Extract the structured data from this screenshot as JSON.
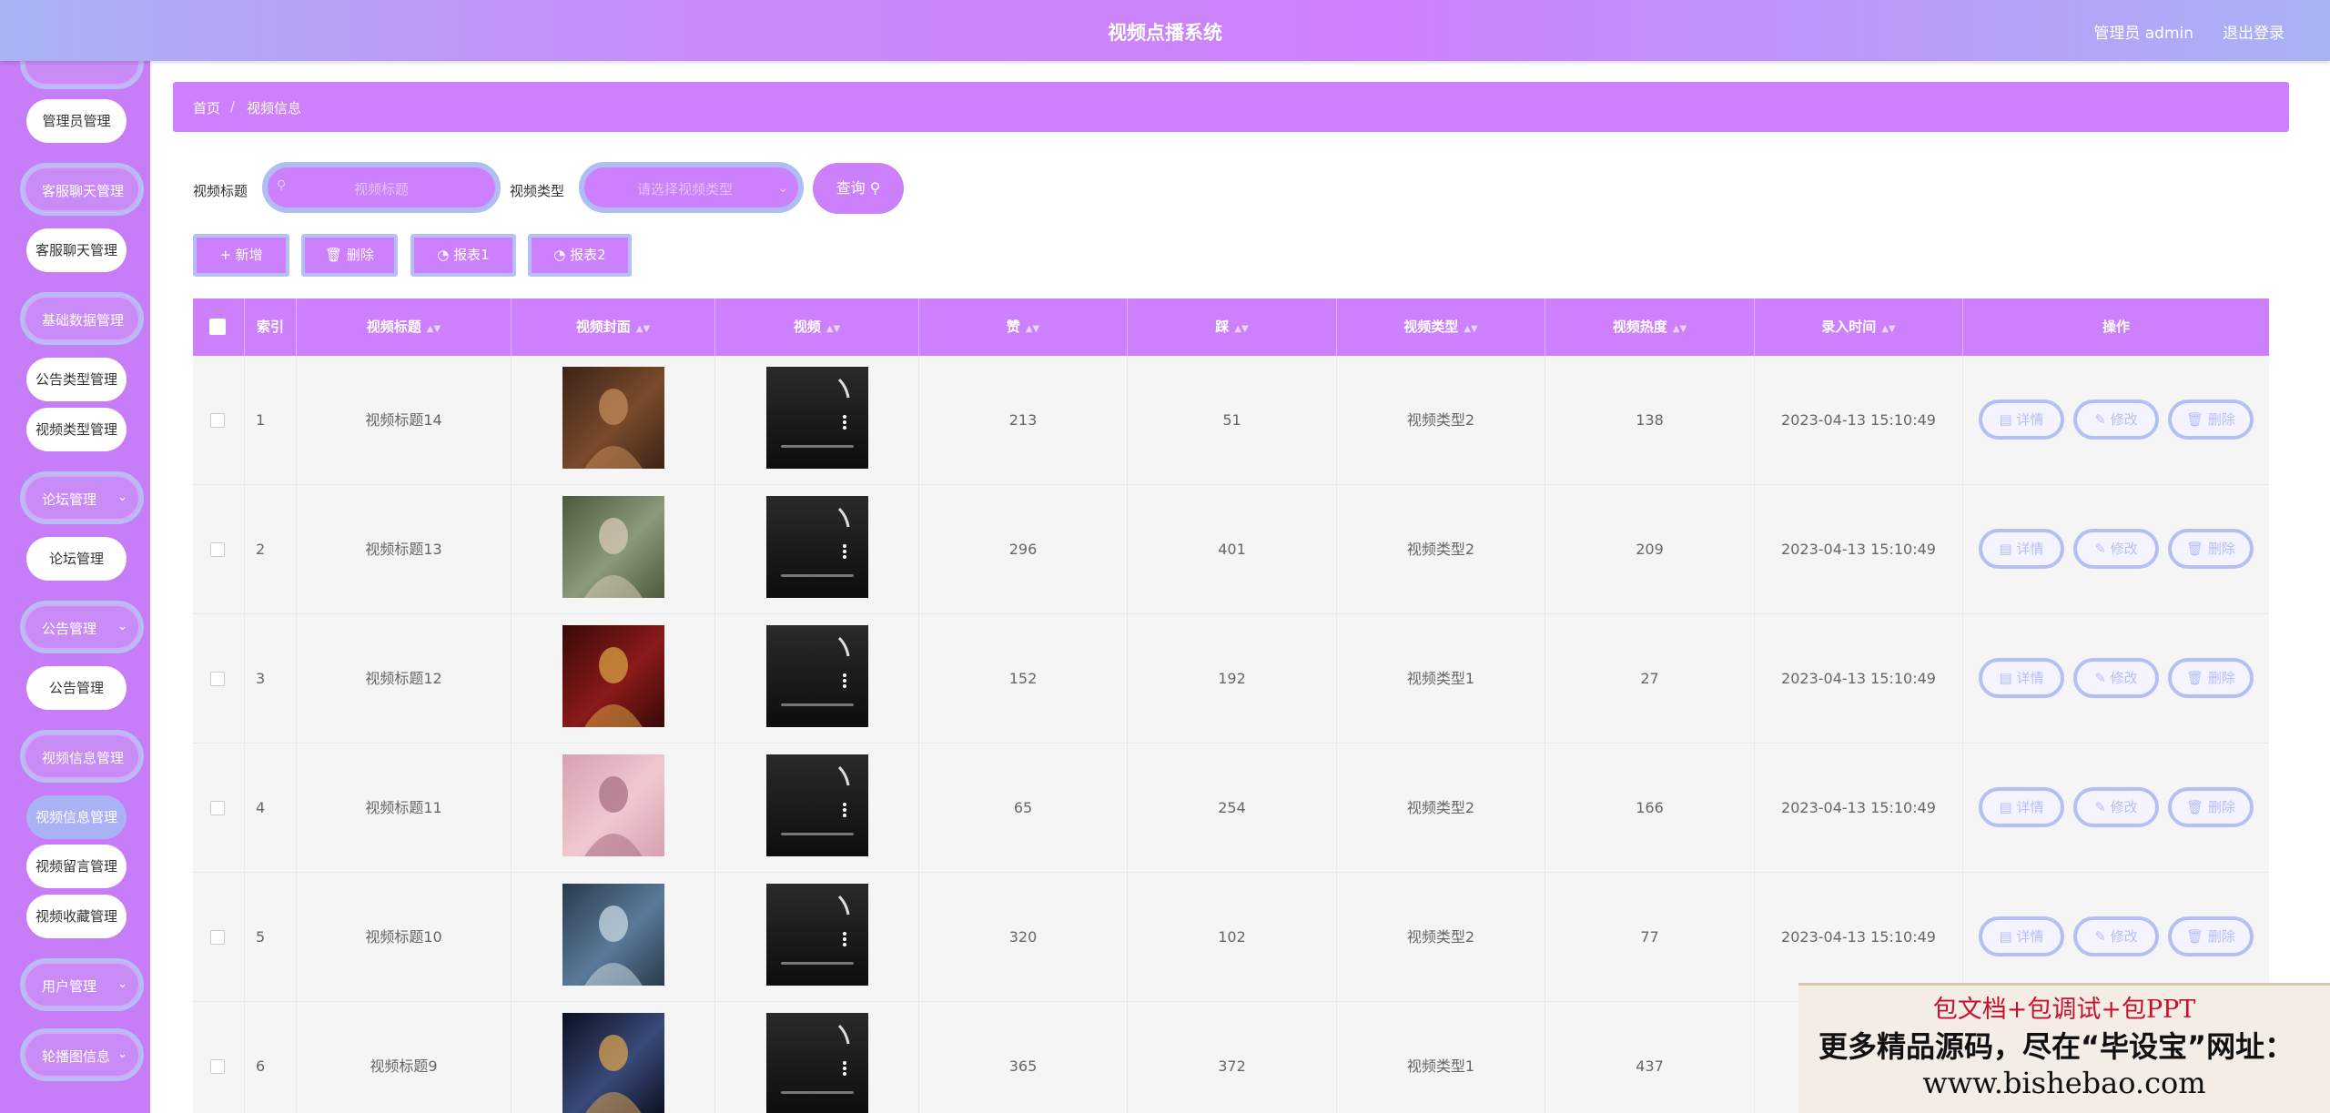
{
  "header": {
    "title": "视频点播系统",
    "admin_label": "管理员 admin",
    "logout_label": "退出登录"
  },
  "sidebar": {
    "groups": [
      {
        "label": "客服聊天管理"
      },
      {
        "label": "基础数据管理"
      },
      {
        "label": "论坛管理"
      },
      {
        "label": "公告管理"
      },
      {
        "label": "视频信息管理"
      },
      {
        "label": "用户管理"
      },
      {
        "label": "轮播图信息"
      }
    ],
    "items": [
      {
        "label": "管理员管理"
      },
      {
        "label": "客服聊天管理"
      },
      {
        "label": "公告类型管理"
      },
      {
        "label": "视频类型管理"
      },
      {
        "label": "论坛管理"
      },
      {
        "label": "公告管理"
      },
      {
        "label": "视频信息管理"
      },
      {
        "label": "视频留言管理"
      },
      {
        "label": "视频收藏管理"
      }
    ]
  },
  "breadcrumb": {
    "home": "首页",
    "sep": "/",
    "current": "视频信息"
  },
  "search": {
    "title_label": "视频标题",
    "title_placeholder": "视频标题",
    "type_label": "视频类型",
    "type_placeholder": "请选择视频类型",
    "query_label": "查询"
  },
  "actions": {
    "add": "新增",
    "delete": "删除",
    "report1": "报表1",
    "report2": "报表2"
  },
  "table": {
    "headers": [
      "索引",
      "视频标题",
      "视频封面",
      "视频",
      "赞",
      "踩",
      "视频类型",
      "视频热度",
      "录入时间",
      "操作"
    ],
    "row_buttons": {
      "detail": "详情",
      "edit": "修改",
      "delete": "删除"
    },
    "rows": [
      {
        "index": "1",
        "title": "视频标题14",
        "likes": "213",
        "dislikes": "51",
        "type": "视频类型2",
        "heat": "138",
        "time": "2023-04-13 15:10:49"
      },
      {
        "index": "2",
        "title": "视频标题13",
        "likes": "296",
        "dislikes": "401",
        "type": "视频类型2",
        "heat": "209",
        "time": "2023-04-13 15:10:49"
      },
      {
        "index": "3",
        "title": "视频标题12",
        "likes": "152",
        "dislikes": "192",
        "type": "视频类型1",
        "heat": "27",
        "time": "2023-04-13 15:10:49"
      },
      {
        "index": "4",
        "title": "视频标题11",
        "likes": "65",
        "dislikes": "254",
        "type": "视频类型2",
        "heat": "166",
        "time": "2023-04-13 15:10:49"
      },
      {
        "index": "5",
        "title": "视频标题10",
        "likes": "320",
        "dislikes": "102",
        "type": "视频类型2",
        "heat": "77",
        "time": "2023-04-13 15:10:49"
      },
      {
        "index": "6",
        "title": "视频标题9",
        "likes": "365",
        "dislikes": "372",
        "type": "视频类型1",
        "heat": "437",
        "time": "20"
      }
    ]
  },
  "ad": {
    "line1": "包文档+包调试+包PPT",
    "line2": "更多精品源码，尽在“毕设宝”网址：",
    "line3": "www.bishebao.com"
  },
  "colors": {
    "primary": "#cc80fb",
    "accent": "#a8b2f5",
    "sidebar": "#c77cf8"
  }
}
